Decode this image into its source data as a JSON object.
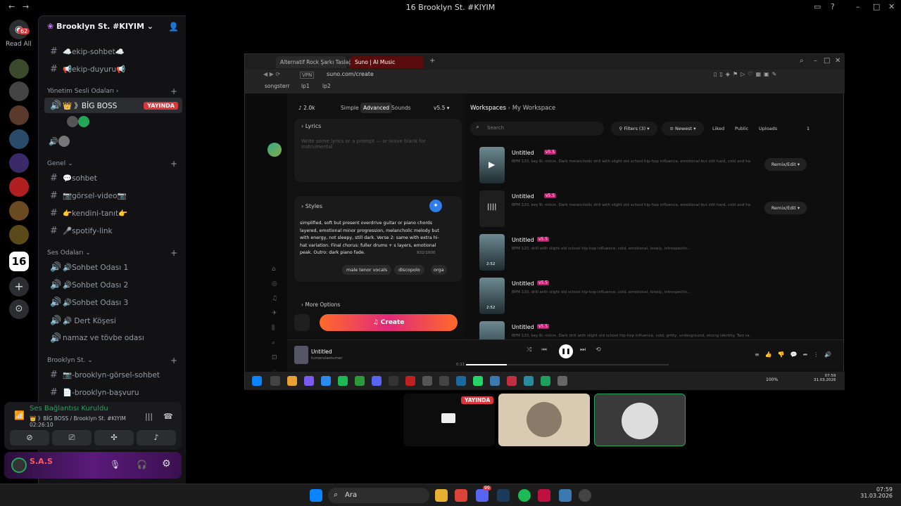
{
  "window": {
    "title": "16 Brooklyn St. #KIYIM"
  },
  "rail": {
    "mention_count": "62",
    "read_all": "Read All"
  },
  "server": {
    "name": "Brooklyn St. #KIYIM"
  },
  "channels": {
    "top": [
      {
        "name": "☁️ekip-sohbet☁️"
      },
      {
        "name": "📢ekip-duyuru📢"
      }
    ],
    "cat_admin": "Yönetim Sesli Odaları",
    "bigboss": "👑 》BİG BOSS",
    "live_badge": "YAYINDA",
    "cat_general": "Genel",
    "general": [
      "💬sohbet",
      "📷görsel-video📷",
      "👉kendini-tanıt👉",
      "🎤spotify-link"
    ],
    "cat_voice": "Ses Odaları",
    "voice": [
      "🔊Sohbet Odası 1",
      "🔊Sohbet Odası 2",
      "🔊Sohbet Odası 3",
      "🔊 Dert Köşesi",
      "namaz ve tövbe odası"
    ],
    "cat_brooklyn": "Brooklyn St.",
    "brooklyn": [
      "📷-brooklyn-görsel-sohbet",
      "📄-brooklyn-başvuru"
    ]
  },
  "voice_panel": {
    "status": "Ses Bağlantısı Kuruldu",
    "location": "👑 》BİG BOSS / Brooklyn St. #KIYIM",
    "timer": "02:26:10"
  },
  "user": {
    "name": "S.A.S"
  },
  "browser": {
    "tabs": [
      "Alternatif Rock Şarkı Taslağı",
      "Suno | AI Music"
    ],
    "url": "suno.com/create",
    "bookmarks": [
      "songsterr",
      "lp1",
      "lp2"
    ]
  },
  "suno": {
    "credits": "2.0k",
    "modes": [
      "Simple",
      "Advanced",
      "Sounds"
    ],
    "version": "v5.5",
    "lyrics_label": "Lyrics",
    "lyrics_placeholder": "Write some lyrics or a prompt — or leave blank for instrumental",
    "styles_label": "Styles",
    "styles_text": "simplified, soft but present overdrive guitar or piano chords layered, emotional minor progression, melancholic melody but with energy, not sleepy, still dark. Verse 2: same with extra hi-hat variation. Final chorus: fuller drums + s layers, emotional peak. Outro: dark piano fade.",
    "char_count": "932/1000",
    "tags": [
      "male tenor vocals",
      "discopolo",
      "orga"
    ],
    "more_options": "More Options",
    "create": "Create",
    "breadcrumb": [
      "Workspaces",
      "My Workspace"
    ],
    "search_placeholder": "Search",
    "filters": "Filters (3)",
    "sort": "Newest",
    "tabs": [
      "Liked",
      "Public",
      "Uploads"
    ],
    "page": "1",
    "songs": [
      {
        "title": "Untitled",
        "badge": "v5.5",
        "desc": "BPM 120, key B♭ minor, Dark melancholic drill with slight old school hip-hop influence, emotional but still hard, cold and ha...",
        "action": "Remix/Edit"
      },
      {
        "title": "Untitled",
        "badge": "v5.5",
        "desc": "BPM 120, key B♭ minor, Dark melancholic drill with slight old school hip-hop influence, emotional but still hard, cold and ha...",
        "action": "Remix/Edit"
      },
      {
        "title": "Untitled",
        "badge": "v5.5",
        "desc": "BPM 120, drill with slight old school hip-hop influence, cold, emotional, lonely, introspectiv...",
        "duration": "2:52"
      },
      {
        "title": "Untitled",
        "badge": "v5.5",
        "desc": "BPM 120, drill with slight old school hip-hop influence, cold, emotional, lonely, introspectiv...",
        "duration": "2:52"
      },
      {
        "title": "Untitled",
        "badge": "v5.5",
        "desc": "BPM 120, key B♭ minor, Dark drill with slight old school hip-hop influence, cold, gritty, underground, strong identity. Two ra..."
      }
    ],
    "player": {
      "title": "Untitled",
      "artist": "tumerulastumer",
      "time": "0:11",
      "progress": 0.2
    }
  },
  "stream_taskbar": {
    "time": "07:59",
    "date": "31.03.2026",
    "battery": "100%"
  },
  "tiles": {
    "live": "YAYINDA"
  },
  "taskbar": {
    "search": "Ara",
    "time": "07:59",
    "date": "31.03.2026",
    "badge": "99"
  }
}
